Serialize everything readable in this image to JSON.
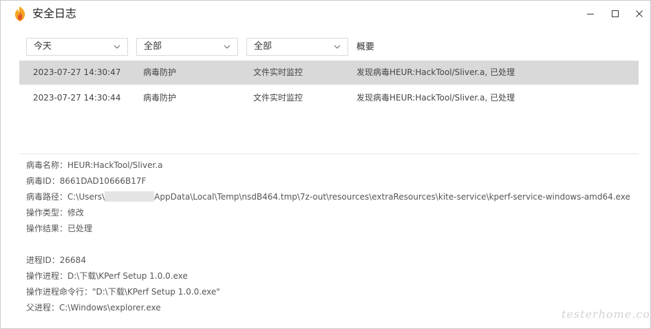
{
  "window": {
    "title": "安全日志",
    "buttons": {
      "minimize": "minimize",
      "maximize": "maximize",
      "close": "close"
    }
  },
  "filters": {
    "date": "今天",
    "category": "全部",
    "type": "全部",
    "summary_header": "概要"
  },
  "rows": [
    {
      "time": "2023-07-27 14:30:47",
      "category": "病毒防护",
      "type": "文件实时监控",
      "summary": "发现病毒HEUR:HackTool/Sliver.a, 已处理",
      "selected": true
    },
    {
      "time": "2023-07-27 14:30:44",
      "category": "病毒防护",
      "type": "文件实时监控",
      "summary": "发现病毒HEUR:HackTool/Sliver.a, 已处理",
      "selected": false
    }
  ],
  "details": {
    "virus_name": "病毒名称：HEUR:HackTool/Sliver.a",
    "virus_id": "病毒ID：8661DAD10666B17F",
    "virus_path_prefix": "病毒路径：C:\\Users\\",
    "virus_path_suffix": "AppData\\Local\\Temp\\nsdB464.tmp\\7z-out\\resources\\extraResources\\kite-service\\kperf-service-windows-amd64.exe",
    "op_type": "操作类型：修改",
    "op_result": "操作结果：已处理",
    "pid": "进程ID：26684",
    "process": "操作进程：D:\\下载\\KPerf Setup 1.0.0.exe",
    "cmdline": "操作进程命令行：\"D:\\下载\\KPerf Setup 1.0.0.exe\"",
    "parent": "父进程：C:\\Windows\\explorer.exe"
  },
  "watermark": "testerhome.com",
  "colors": {
    "selected_row": "#d9d9d9",
    "logo_orange": "#f5a623",
    "logo_red": "#e2522c"
  }
}
